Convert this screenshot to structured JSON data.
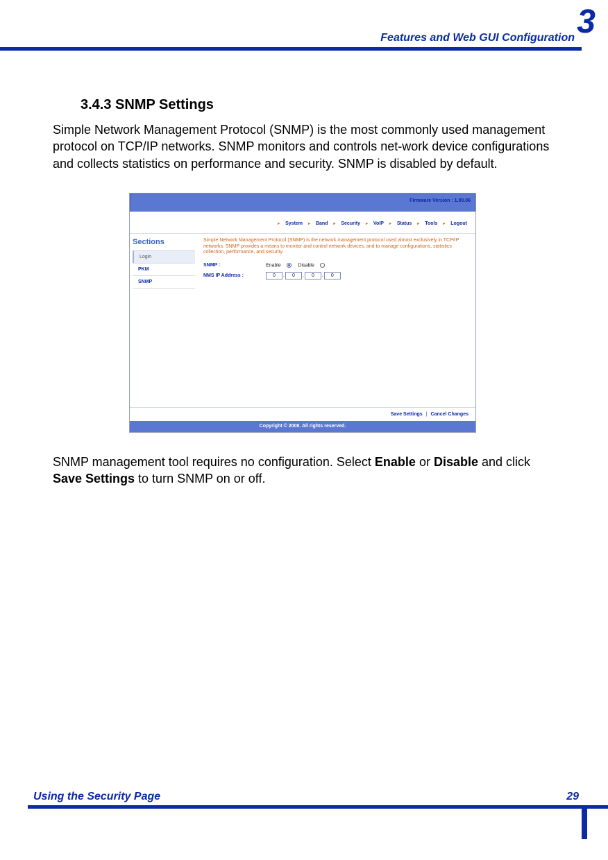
{
  "header": {
    "title": "Features and Web GUI Configuration",
    "chapter": "3"
  },
  "section": {
    "heading": "3.4.3 SNMP Settings",
    "para1": "Simple Network Management Protocol (SNMP) is the most commonly used management protocol on TCP/IP networks. SNMP monitors and controls net-work device configurations and collects statistics on performance and security. SNMP is disabled by default.",
    "para2a": "SNMP management tool requires no configuration. Select ",
    "para2b": "Enable",
    "para2c": " or ",
    "para2d": "Disable",
    "para2e": " and click ",
    "para2f": "Save Settings",
    "para2g": " to turn SNMP on or off."
  },
  "screenshot": {
    "firmware": "Firmware Version : 1.00.06",
    "nav": {
      "system": "System",
      "band": "Band",
      "security": "Security",
      "voip": "VoIP",
      "status": "Status",
      "tools": "Tools",
      "logout": "Logout"
    },
    "sidebar": {
      "title": "Sections",
      "items": [
        "Login",
        "PKM",
        "SNMP"
      ]
    },
    "desc": "Simple Network Management Protocol (SNMP) is the network management protocol used almost exclusively in TCP/IP networks. SNMP provides a means to monitor and control network devices, and to manage configurations, statistics collection, performance, and security.",
    "fields": {
      "snmp_label": "SNMP :",
      "enable": "Enable",
      "disable": "Disable",
      "nms_label": "NMS IP Address :",
      "ip": [
        "0",
        "0",
        "0",
        "0"
      ]
    },
    "actions": {
      "save": "Save Settings",
      "cancel": "Cancel Changes"
    },
    "copyright": "Copyright © 2008. All rights reserved."
  },
  "footer": {
    "title": "Using the Security Page",
    "page": "29"
  }
}
